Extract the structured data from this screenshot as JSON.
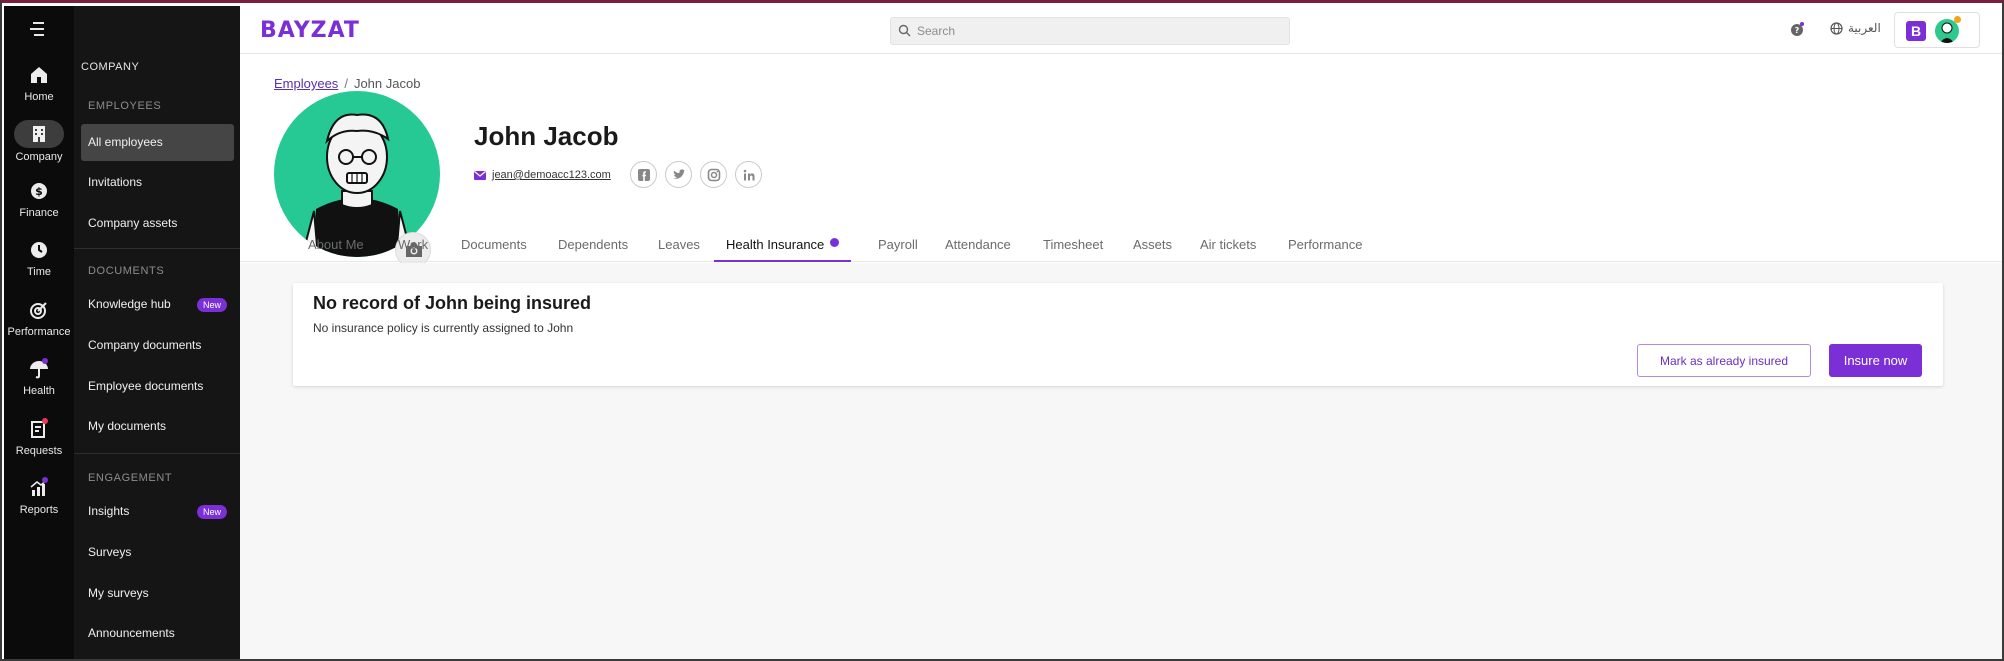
{
  "brand": {
    "logo_text": "BAYZAT",
    "accent": "#7b2fd6"
  },
  "topbar": {
    "search_placeholder": "Search",
    "language_label": "العربية",
    "account_badge": "B",
    "icons": [
      "search-icon",
      "help-icon",
      "globe-icon",
      "avatar"
    ]
  },
  "rail": {
    "items": [
      {
        "label": "Home",
        "icon": "home-icon"
      },
      {
        "label": "Company",
        "icon": "building-icon",
        "active": true
      },
      {
        "label": "Finance",
        "icon": "dollar-icon"
      },
      {
        "label": "Time",
        "icon": "clock-icon"
      },
      {
        "label": "Performance",
        "icon": "target-icon"
      },
      {
        "label": "Health",
        "icon": "umbrella-icon",
        "dot_color": "#7b2fd6"
      },
      {
        "label": "Requests",
        "icon": "request-icon",
        "dot_color": "#e8395b"
      },
      {
        "label": "Reports",
        "icon": "chart-icon",
        "dot_color": "#7b2fd6"
      }
    ]
  },
  "sidebar": {
    "title": "COMPANY",
    "sections": [
      {
        "heading": "EMPLOYEES",
        "items": [
          {
            "label": "All employees",
            "active": true
          },
          {
            "label": "Invitations"
          },
          {
            "label": "Company assets"
          }
        ]
      },
      {
        "heading": "DOCUMENTS",
        "items": [
          {
            "label": "Knowledge hub",
            "badge": "New"
          },
          {
            "label": "Company documents"
          },
          {
            "label": "Employee documents"
          },
          {
            "label": "My documents"
          }
        ]
      },
      {
        "heading": "ENGAGEMENT",
        "items": [
          {
            "label": "Insights",
            "badge": "New"
          },
          {
            "label": "Surveys"
          },
          {
            "label": "My surveys"
          },
          {
            "label": "Announcements"
          }
        ]
      }
    ]
  },
  "breadcrumb": {
    "parent": "Employees",
    "separator": "/",
    "current": "John Jacob"
  },
  "profile": {
    "name": "John Jacob",
    "email": "jean@demoacc123.com",
    "social": [
      "facebook-icon",
      "twitter-icon",
      "instagram-icon",
      "linkedin-icon"
    ]
  },
  "tabs": [
    {
      "label": "About Me"
    },
    {
      "label": "Work"
    },
    {
      "label": "Documents"
    },
    {
      "label": "Dependents"
    },
    {
      "label": "Leaves"
    },
    {
      "label": "Health Insurance",
      "active": true,
      "dot": true
    },
    {
      "label": "Payroll"
    },
    {
      "label": "Attendance"
    },
    {
      "label": "Timesheet"
    },
    {
      "label": "Assets"
    },
    {
      "label": "Air tickets"
    },
    {
      "label": "Performance"
    }
  ],
  "insurance_card": {
    "title": "No record of John being insured",
    "subtitle": "No insurance policy is currently assigned to John",
    "secondary_button": "Mark as already insured",
    "primary_button": "Insure now"
  }
}
